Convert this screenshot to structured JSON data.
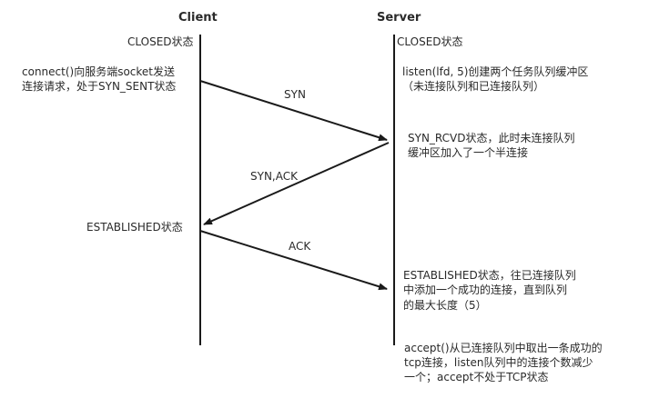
{
  "header": {
    "client": "Client",
    "server": "Server"
  },
  "client_notes": {
    "closed": "CLOSED状态",
    "connect_line1": "connect()向服务端socket发送",
    "connect_line2": "连接请求，处于SYN_SENT状态",
    "established": "ESTABLISHED状态"
  },
  "server_notes": {
    "closed": "CLOSED状态",
    "listen_line1": "listen(lfd, 5)创建两个任务队列缓冲区",
    "listen_line2": "（未连接队列和已连接队列）",
    "synrcvd_line1": "SYN_RCVD状态，此时未连接队列",
    "synrcvd_line2": "缓冲区加入了一个半连接",
    "est_line1": "ESTABLISHED状态，往已连接队列",
    "est_line2": "中添加一个成功的连接，直到队列",
    "est_line3": "的最大长度（5）",
    "accept_line1": "accept()从已连接队列中取出一条成功的",
    "accept_line2": "tcp连接，listen队列中的连接个数减少",
    "accept_line3": "一个；accept不处于TCP状态"
  },
  "messages": {
    "syn": "SYN",
    "synack": "SYN,ACK",
    "ack": "ACK"
  },
  "colors": {
    "line": "#1a1a1a",
    "text": "#2a2a2a"
  }
}
